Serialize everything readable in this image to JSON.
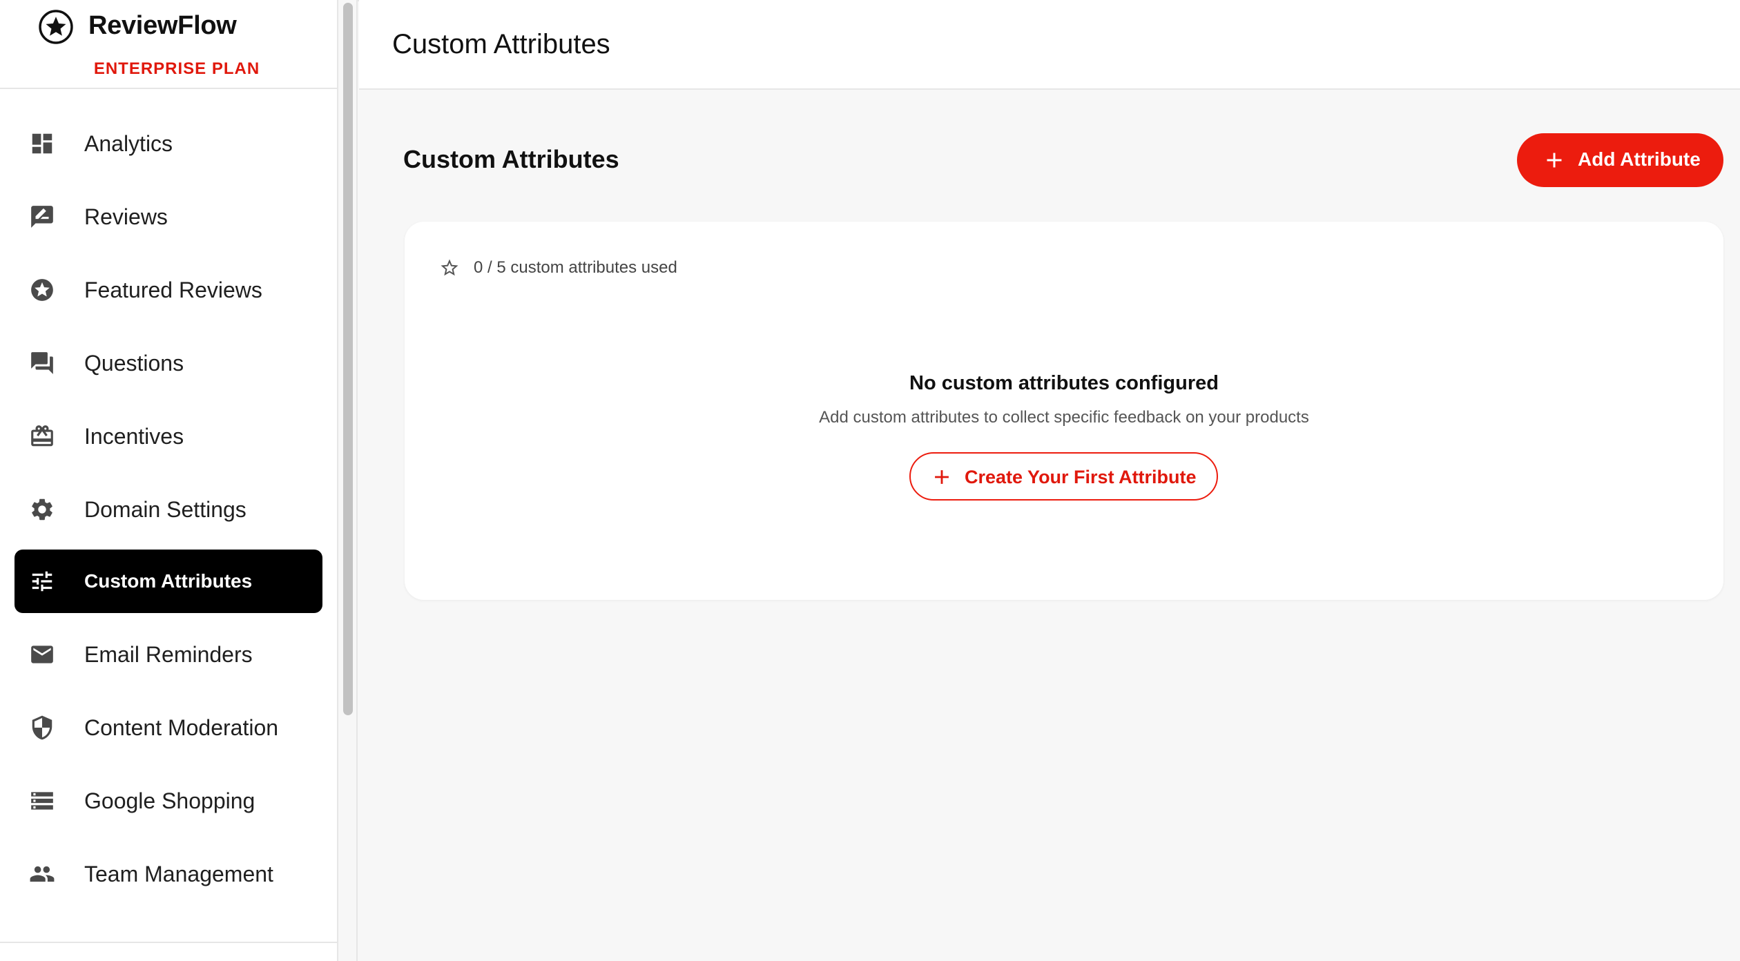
{
  "brand": {
    "name": "ReviewFlow",
    "plan": "ENTERPRISE PLAN",
    "logo_icon": "star-circle-icon"
  },
  "colors": {
    "accent": "#ec1c0e",
    "active_nav_bg": "#000000",
    "plan_text": "#e0180c"
  },
  "sidebar": {
    "items": [
      {
        "label": "Analytics",
        "icon": "dashboard-icon"
      },
      {
        "label": "Reviews",
        "icon": "rate-review-icon"
      },
      {
        "label": "Featured Reviews",
        "icon": "stars-icon"
      },
      {
        "label": "Questions",
        "icon": "forum-icon"
      },
      {
        "label": "Incentives",
        "icon": "redeem-icon"
      },
      {
        "label": "Domain Settings",
        "icon": "gear-icon"
      },
      {
        "label": "Custom Attributes",
        "icon": "tune-icon",
        "active": true
      },
      {
        "label": "Email Reminders",
        "icon": "email-icon"
      },
      {
        "label": "Content Moderation",
        "icon": "shield-icon"
      },
      {
        "label": "Google Shopping",
        "icon": "storage-icon"
      },
      {
        "label": "Team Management",
        "icon": "people-icon"
      }
    ]
  },
  "header": {
    "title": "Custom Attributes"
  },
  "main": {
    "section_title": "Custom Attributes",
    "add_button_label": "Add Attribute",
    "usage_text": "0 / 5 custom attributes used",
    "empty_title": "No custom attributes configured",
    "empty_description": "Add custom attributes to collect specific feedback on your products",
    "create_button_label": "Create Your First Attribute"
  }
}
